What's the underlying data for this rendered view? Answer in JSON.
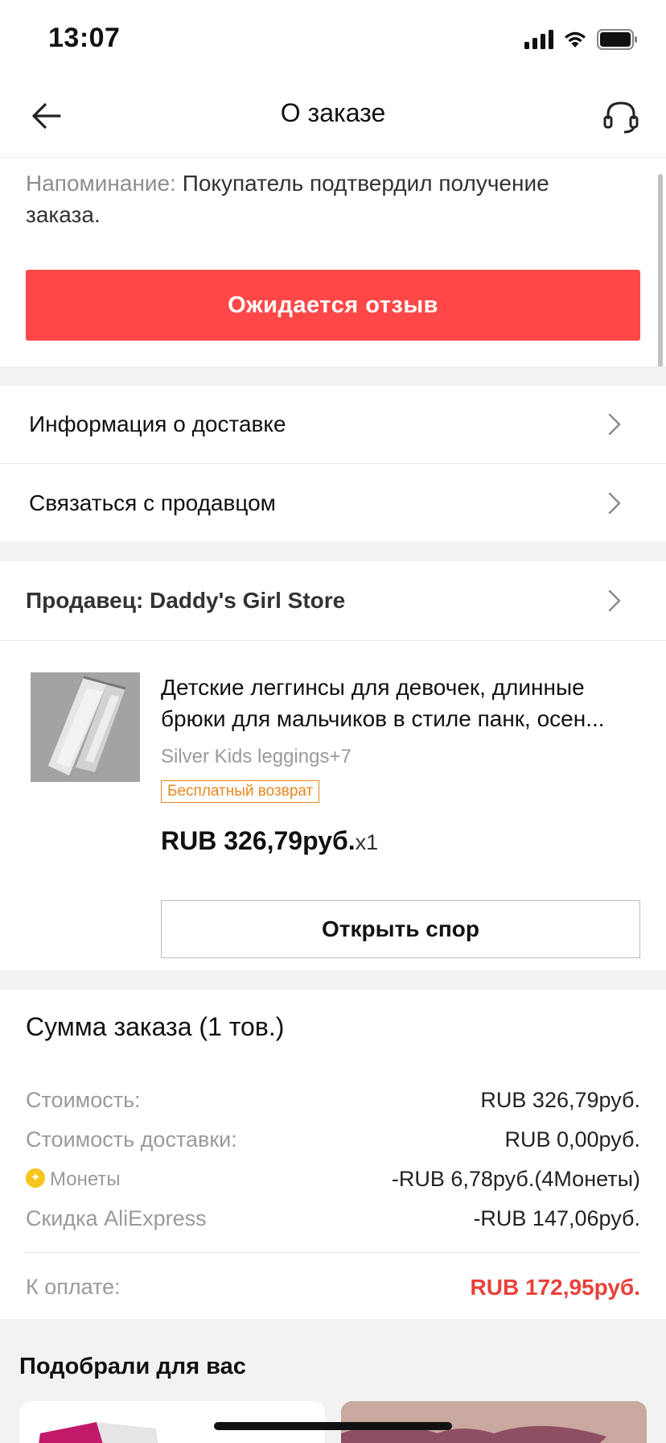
{
  "status": {
    "time": "13:07"
  },
  "nav": {
    "title": "О заказе"
  },
  "reminder": {
    "label": "Напоминание:",
    "text": "Покупатель подтвердил получение заказа."
  },
  "status_button": {
    "label": "Ожидается отзыв"
  },
  "links": {
    "delivery_info": "Информация о доставке",
    "contact_seller": "Связаться с продавцом"
  },
  "seller": {
    "label": "Продавец: Daddy's Girl Store"
  },
  "product": {
    "title": "Детские леггинсы для девочек, длинные брюки для мальчиков в стиле панк, осен...",
    "sku": "Silver Kids leggings+7",
    "badge": "Бесплатный возврат",
    "price": "RUB 326,79руб.",
    "qty": "x1"
  },
  "dispute_button": {
    "label": "Открыть спор"
  },
  "summary": {
    "title": "Сумма заказа (1 тов.)",
    "rows": [
      {
        "key": "Стоимость:",
        "value": "RUB 326,79руб."
      },
      {
        "key": "Стоимость доставки:",
        "value": "RUB 0,00руб."
      },
      {
        "key": "Монеты",
        "value": "-RUB 6,78руб.(4Монеты)"
      },
      {
        "key": "Скидка AliExpress",
        "value": "-RUB 147,06руб."
      }
    ],
    "total_key": "К оплате:",
    "total_value": "RUB 172,95руб."
  },
  "recommendations": {
    "title": "Подобрали для вас"
  },
  "colors": {
    "accent_red": "#ff4747",
    "total_red": "#e8413a",
    "badge_orange": "#e8871e",
    "coin_yellow": "#f7c51b",
    "section_gap": "#f2f2f2"
  },
  "icons": [
    "back-arrow-icon",
    "headset-icon",
    "chevron-right-icon",
    "coin-icon",
    "signal-icon",
    "wifi-icon",
    "battery-icon"
  ]
}
